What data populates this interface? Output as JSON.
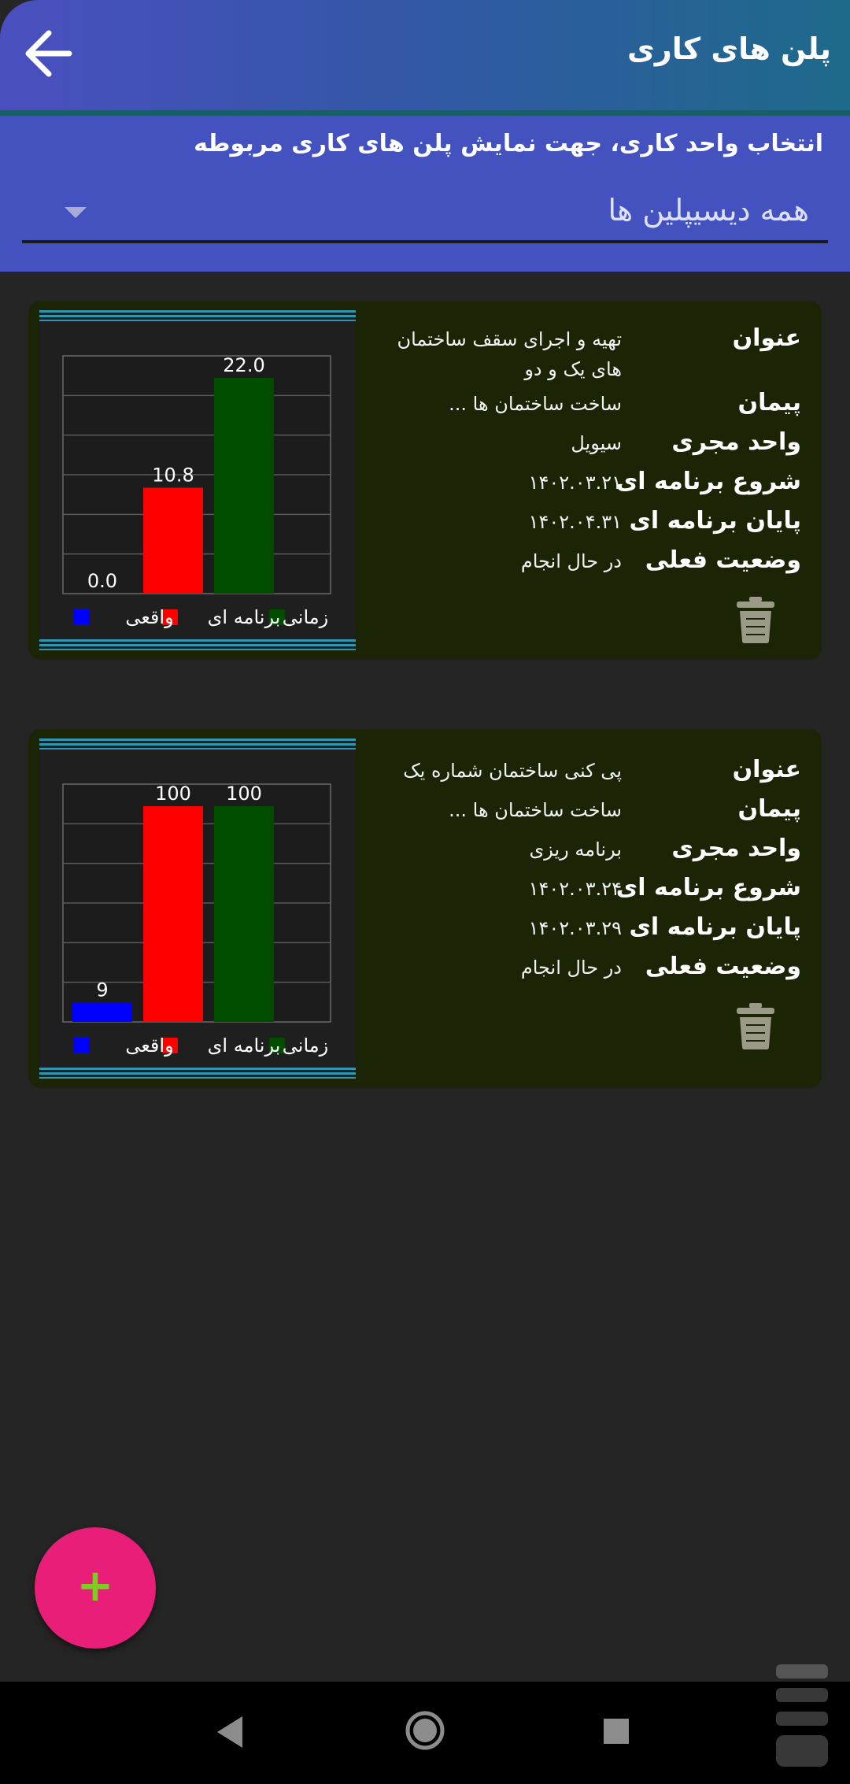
{
  "app_bar": {
    "title": "پلن های کاری"
  },
  "filter": {
    "label": "انتخاب واحد کاری، جهت نمایش پلن های کاری مربوطه",
    "selected": "همه دیسیپلین ها"
  },
  "field_labels": {
    "title": "عنوان",
    "contract": "پیمان",
    "unit": "واحد مجری",
    "start": "شروع برنامه ای",
    "end": "پایان برنامه ای",
    "status": "وضعیت فعلی"
  },
  "legend": {
    "actual": "واقعی",
    "planned": "برنامه ای",
    "time": "زمانی"
  },
  "colors": {
    "actual": "#0000ff",
    "planned": "#ff0000",
    "time": "#004d00"
  },
  "plans": [
    {
      "title": "تهیه و اجرای سقف ساختمان های یک و دو",
      "contract": "ساخت ساختمان ها ...",
      "unit": "سیویل",
      "start": "۱۴۰۲.۰۳.۲۱",
      "end": "۱۴۰۲.۰۴.۳۱",
      "status": "در حال انجام",
      "bar_labels": {
        "actual": "0.0",
        "planned": "10.8",
        "time": "22.0"
      }
    },
    {
      "title": "پی کنی ساختمان شماره یک",
      "contract": "ساخت ساختمان ها ...",
      "unit": "برنامه ریزی",
      "start": "۱۴۰۲.۰۳.۲۴",
      "end": "۱۴۰۲.۰۳.۲۹",
      "status": "در حال انجام",
      "bar_labels": {
        "actual": "9",
        "planned": "100",
        "time": "100"
      }
    }
  ],
  "chart_data": [
    {
      "type": "bar",
      "categories": [
        "واقعی",
        "برنامه ای",
        "زمانی"
      ],
      "values": [
        0.0,
        10.8,
        22.0
      ],
      "ylim": [
        0,
        22.0
      ]
    },
    {
      "type": "bar",
      "categories": [
        "واقعی",
        "برنامه ای",
        "زمانی"
      ],
      "values": [
        9,
        100,
        100
      ],
      "ylim": [
        0,
        100
      ]
    }
  ],
  "fab": {
    "label": "+"
  }
}
